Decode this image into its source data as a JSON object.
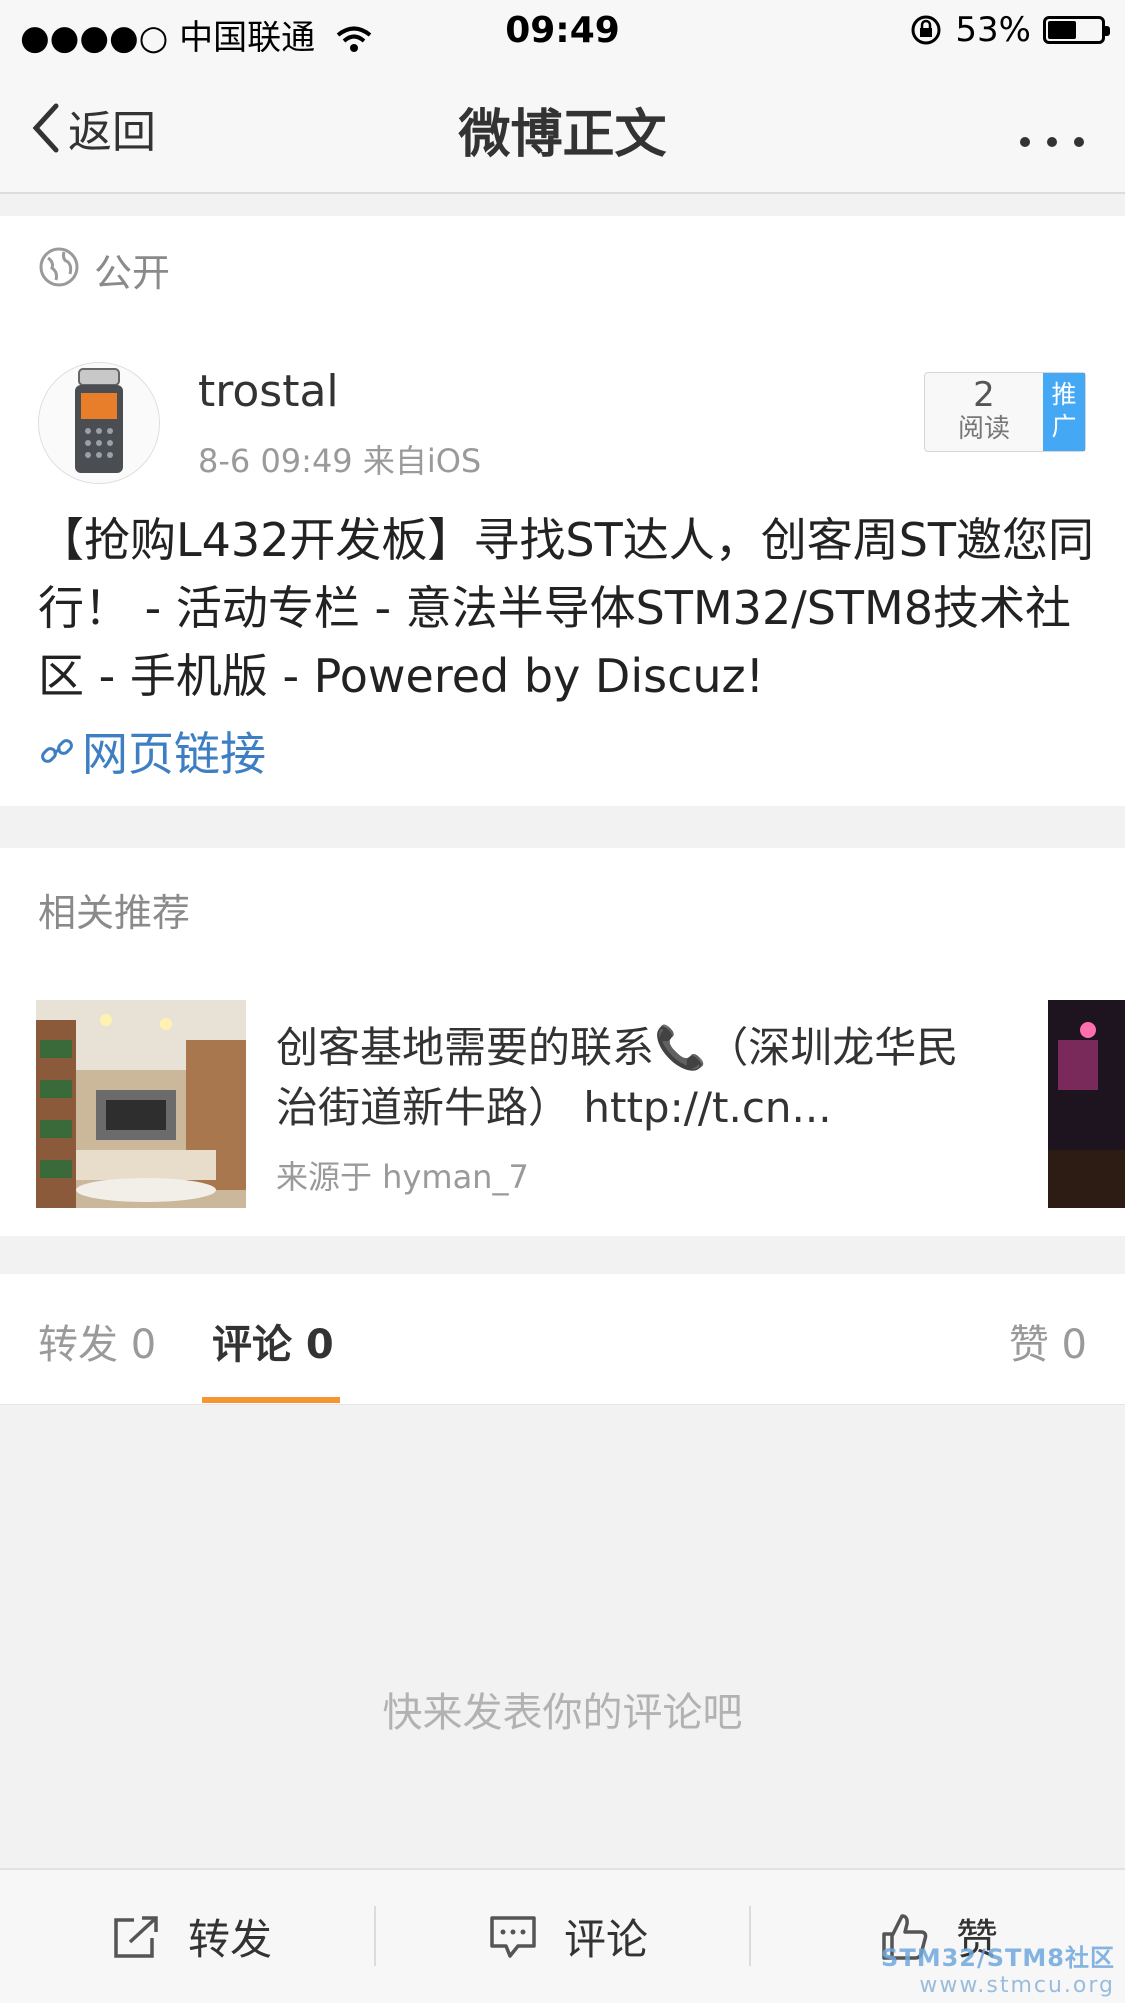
{
  "status_bar": {
    "signal": "●●●●○",
    "carrier": "中国联通",
    "time": "09:49",
    "battery_percent": "53%",
    "battery_level": 0.53
  },
  "nav": {
    "back_label": "返回",
    "title": "微博正文"
  },
  "visibility": {
    "label": "公开"
  },
  "post": {
    "username": "trostal",
    "meta": "8-6 09:49  来自iOS",
    "read_count": "2",
    "read_label": "阅读",
    "promo_label": "推广",
    "text": "【抢购L432开发板】寻找ST达人，创客周ST邀您同行！ - 活动专栏 - 意法半导体STM32/STM8技术社区 - 手机版 - Powered by Discuz!",
    "link_label": "网页链接"
  },
  "related": {
    "header": "相关推荐",
    "items": [
      {
        "title": "创客基地需要的联系📞（深圳龙华民治街道新牛路） http://t.cn...",
        "source": "来源于 hyman_7"
      }
    ]
  },
  "tabs": [
    {
      "label": "转发 0"
    },
    {
      "label": "评论 0",
      "active": true
    },
    {
      "label": "赞 0"
    }
  ],
  "comments": {
    "empty_text": "快来发表你的评论吧"
  },
  "toolbar": {
    "repost_label": "转发",
    "comment_label": "评论",
    "like_label": "赞"
  },
  "watermark": {
    "line1": "STM32/STM8社区",
    "line2": "www.stmcu.org"
  },
  "colors": {
    "accent_tab": "#f79533",
    "link": "#3e7fc4",
    "promo": "#44a8f5"
  }
}
